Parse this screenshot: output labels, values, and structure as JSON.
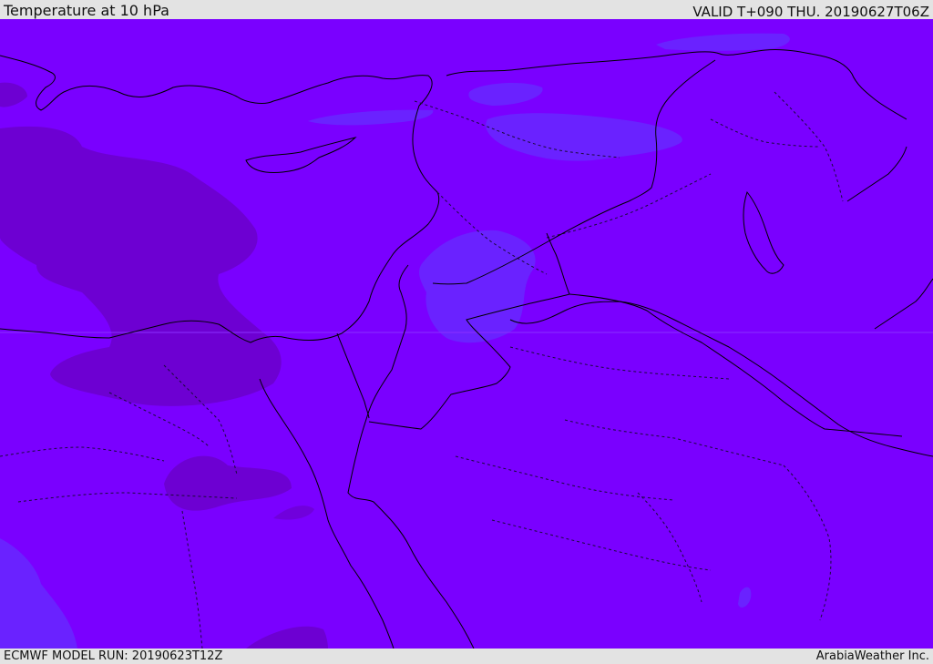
{
  "header": {
    "title": "Temperature at 10 hPa",
    "valid_time": "VALID T+090 THU. 20190627T06Z"
  },
  "footer": {
    "model_run": "ECMWF MODEL RUN: 20190623T12Z",
    "credit": "ArabiaWeather Inc."
  },
  "map": {
    "colors": {
      "base_field": "#7a00ff",
      "cooler_field": "#6d00d2",
      "warmer_field": "#6a22ff",
      "coastline": "#000000",
      "border": "#1a0a3a"
    }
  }
}
